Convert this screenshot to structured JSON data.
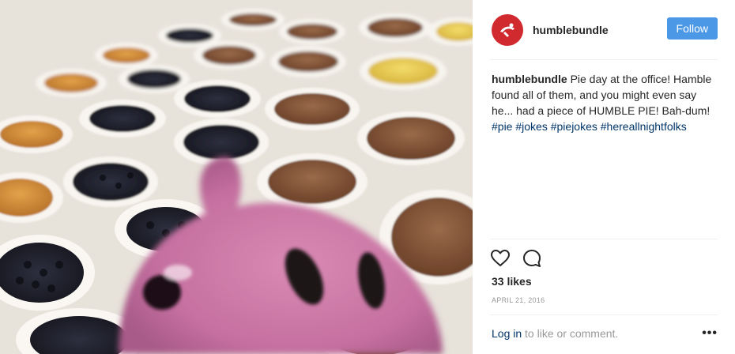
{
  "account": {
    "username": "humblebundle",
    "follow_label": "Follow"
  },
  "caption": {
    "username": "humblebundle",
    "text": "Pie day at the office! Hamble found all of them, and you might even say he... had a piece of HUMBLE PIE! Bah-dum!",
    "hashtags": [
      "#pie",
      "#jokes",
      "#piejokes",
      "#hereallnightfolks"
    ]
  },
  "stats": {
    "likes": "33 likes",
    "date": "APRIL 21, 2016"
  },
  "footer": {
    "login_label": "Log in",
    "login_suffix": "to like or comment.",
    "more_label": "•••"
  },
  "icons": {
    "avatar": "humble-bundle-logo-icon",
    "like": "heart-icon",
    "comment": "comment-bubble-icon",
    "more": "more-options-icon"
  },
  "colors": {
    "follow_button": "#4b98e6",
    "avatar_bg": "#d0292e",
    "hashtag": "#003569",
    "muted": "#999999"
  }
}
